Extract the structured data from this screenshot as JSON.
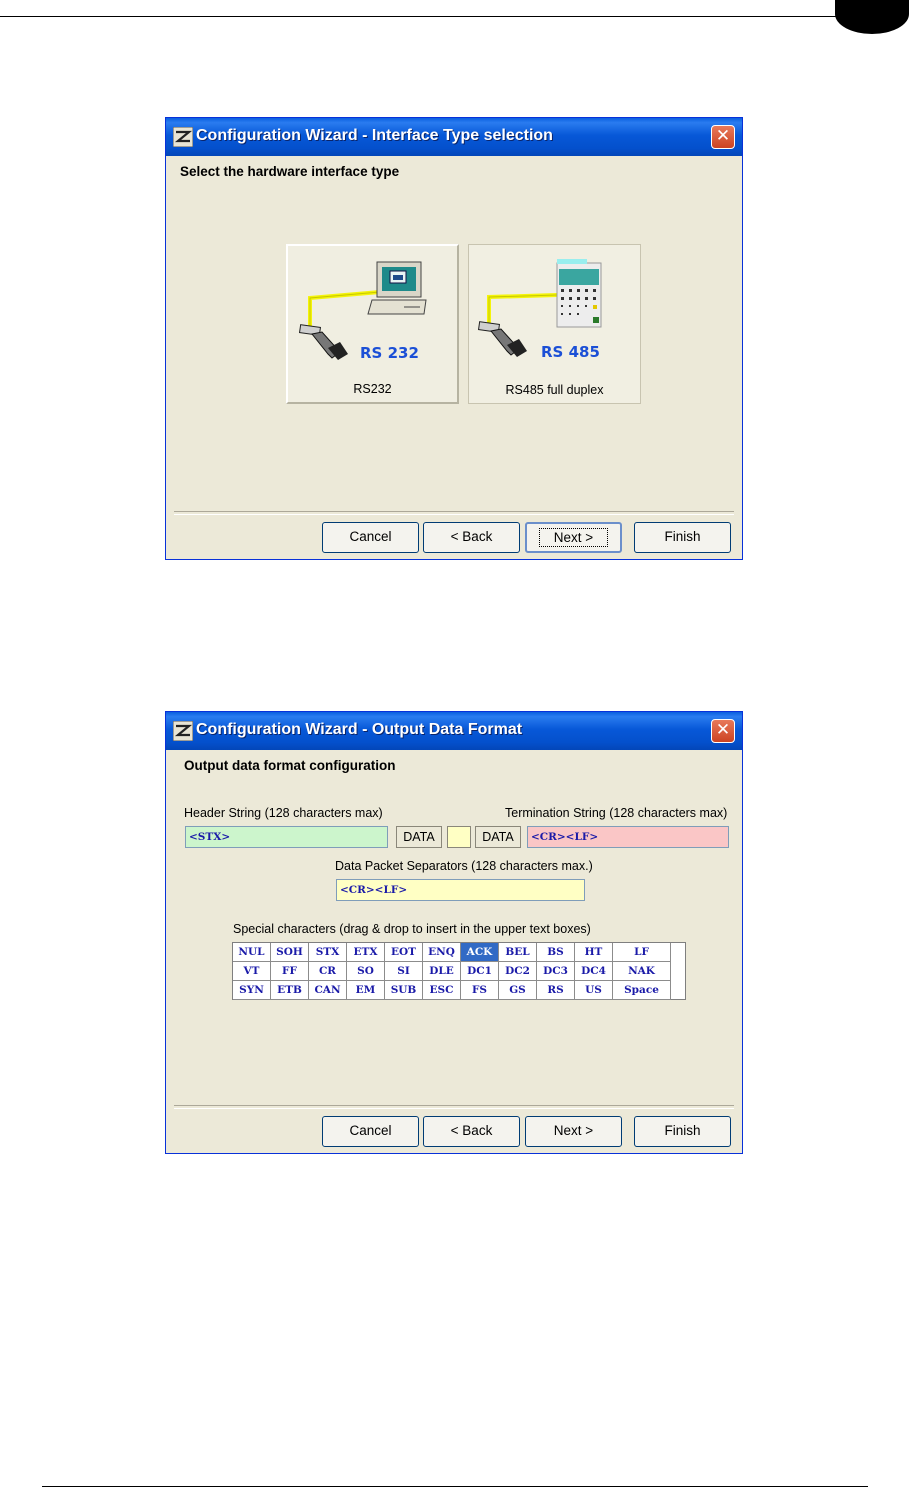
{
  "wizard1": {
    "title": "Configuration Wizard - Interface Type selection",
    "heading": "Select the hardware interface type",
    "options": [
      {
        "badge": "RS 232",
        "caption": "RS232"
      },
      {
        "badge": "RS 485",
        "caption": "RS485 full duplex"
      }
    ],
    "buttons": {
      "cancel": "Cancel",
      "back": "< Back",
      "next": "Next >",
      "finish": "Finish"
    }
  },
  "wizard2": {
    "title": "Configuration Wizard - Output Data Format",
    "heading": "Output data format configuration",
    "header_label": "Header String (128 characters max)",
    "header_value": "<STX>",
    "termination_label": "Termination String (128 characters max)",
    "termination_value": "<CR><LF>",
    "data_label": "DATA",
    "separator_label": "Data Packet Separators (128 characters max.)",
    "separator_value": "<CR><LF>",
    "special_label": "Special characters (drag & drop to insert in the upper text boxes)",
    "special_rows": [
      [
        "NUL",
        "SOH",
        "STX",
        "ETX",
        "EOT",
        "ENQ",
        "ACK",
        "BEL",
        "BS",
        "HT",
        "LF"
      ],
      [
        "VT",
        "FF",
        "CR",
        "SO",
        "SI",
        "DLE",
        "DC1",
        "DC2",
        "DC3",
        "DC4",
        "NAK"
      ],
      [
        "SYN",
        "ETB",
        "CAN",
        "EM",
        "SUB",
        "ESC",
        "FS",
        "GS",
        "RS",
        "US",
        "Space"
      ]
    ],
    "highlighted_char": "ACK",
    "buttons": {
      "cancel": "Cancel",
      "back": "< Back",
      "next": "Next >",
      "finish": "Finish"
    }
  },
  "colors": {
    "title_bar": "#0758d8",
    "dialog_face": "#ece9d8",
    "header_box": "#ccf5cc",
    "termination_box": "#fac6c6",
    "separator_box": "#ffffc4",
    "char_text": "#1a1aa8",
    "char_highlight": "#316ac5"
  },
  "icons": [
    "wizard-app-icon",
    "close-icon",
    "pc-terminal-icon",
    "plc-device-icon",
    "serial-cable-icon"
  ]
}
